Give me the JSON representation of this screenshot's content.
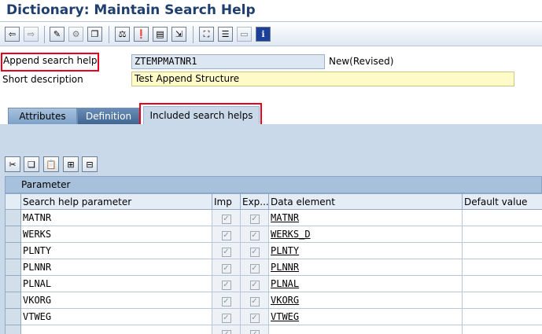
{
  "window": {
    "title": "Dictionary: Maintain Search Help"
  },
  "toolbar": {
    "buttons": [
      {
        "name": "back-icon",
        "glyph": "⇦"
      },
      {
        "name": "forward-icon",
        "glyph": "⇨"
      },
      {
        "name": "display-change-icon",
        "glyph": "✎"
      },
      {
        "name": "active-inactive-icon",
        "glyph": "⚙"
      },
      {
        "name": "other-object-icon",
        "glyph": "❐"
      },
      {
        "name": "check-icon",
        "glyph": "⚖"
      },
      {
        "name": "activate-icon",
        "glyph": "❗"
      },
      {
        "name": "where-used-icon",
        "glyph": "▤"
      },
      {
        "name": "navigate-icon",
        "glyph": "⇲"
      },
      {
        "name": "hierarchy-icon",
        "glyph": "⛶"
      },
      {
        "name": "display-object-list-icon",
        "glyph": "☰"
      },
      {
        "name": "test-icon",
        "glyph": "▭"
      },
      {
        "name": "info-icon",
        "glyph": "ℹ"
      }
    ]
  },
  "form": {
    "append_label": "Append search help",
    "append_value": "ZTEMPMATNR1",
    "status": "New(Revised)",
    "short_desc_label": "Short description",
    "short_desc_value": "Test Append Structure"
  },
  "tabs": {
    "attributes": "Attributes",
    "definition": "Definition",
    "included": "Included search helps"
  },
  "table": {
    "title": "Parameter",
    "headers": {
      "param": "Search help parameter",
      "imp": "Imp",
      "exp": "Exp...",
      "data_element": "Data element",
      "default_value": "Default value"
    },
    "rows": [
      {
        "param": "MATNR",
        "imp": true,
        "exp": true,
        "data_element": "MATNR"
      },
      {
        "param": "WERKS",
        "imp": true,
        "exp": true,
        "data_element": "WERKS_D"
      },
      {
        "param": "PLNTY",
        "imp": true,
        "exp": true,
        "data_element": "PLNTY"
      },
      {
        "param": "PLNNR",
        "imp": true,
        "exp": true,
        "data_element": "PLNNR"
      },
      {
        "param": "PLNAL",
        "imp": true,
        "exp": true,
        "data_element": "PLNAL"
      },
      {
        "param": "VKORG",
        "imp": true,
        "exp": true,
        "data_element": "VKORG"
      },
      {
        "param": "VTWEG",
        "imp": true,
        "exp": true,
        "data_element": "VTWEG"
      },
      {
        "param": "",
        "imp": true,
        "exp": true,
        "data_element": ""
      }
    ]
  },
  "colors": {
    "highlight": "#e8001c",
    "title": "#1f3f6e",
    "field_edit": "#fffbc7"
  }
}
